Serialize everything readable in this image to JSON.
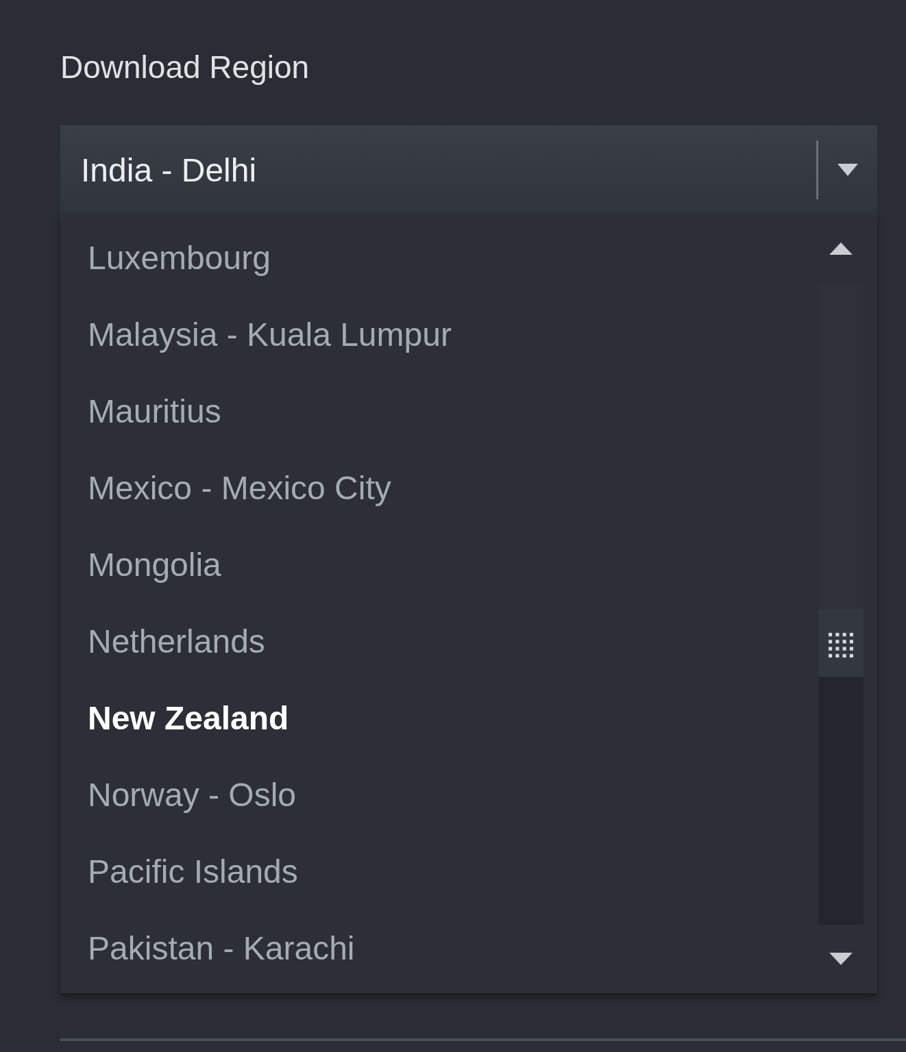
{
  "section_title": "Download Region",
  "dropdown": {
    "value": "India - Delhi",
    "options": [
      {
        "label": "Luxembourg",
        "selected": false
      },
      {
        "label": "Malaysia - Kuala Lumpur",
        "selected": false
      },
      {
        "label": "Mauritius",
        "selected": false
      },
      {
        "label": "Mexico - Mexico City",
        "selected": false
      },
      {
        "label": "Mongolia",
        "selected": false
      },
      {
        "label": "Netherlands",
        "selected": false
      },
      {
        "label": "New Zealand",
        "selected": true
      },
      {
        "label": "Norway - Oslo",
        "selected": false
      },
      {
        "label": "Pacific Islands",
        "selected": false
      },
      {
        "label": "Pakistan - Karachi",
        "selected": false
      }
    ]
  }
}
